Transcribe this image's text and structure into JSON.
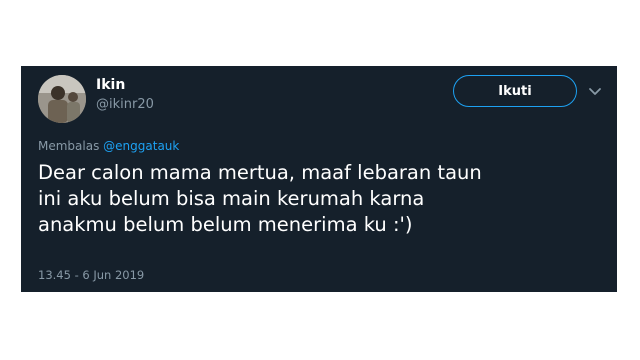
{
  "tweet": {
    "display_name": "Ikin",
    "handle": "@ikinr20",
    "follow_label": "Ikuti",
    "reply_prefix": "Membalas",
    "reply_to": "@enggatauk",
    "text_lines": [
      "Dear calon mama mertua, maaf lebaran taun",
      "ini aku belum bisa main kerumah karna",
      "anakmu belum belum menerima ku :')"
    ],
    "timestamp": "13.45 - 6 Jun 2019"
  },
  "colors": {
    "card_background": "#15202b",
    "accent": "#1da1f2",
    "muted_text": "#8899a6"
  },
  "icons": {
    "avatar": "profile-photo",
    "more": "chevron-down-icon"
  }
}
